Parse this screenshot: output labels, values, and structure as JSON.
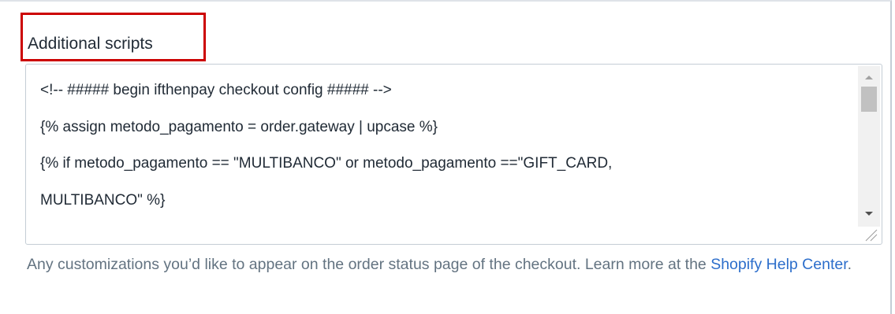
{
  "field": {
    "label": "Additional scripts"
  },
  "textarea": {
    "lines": [
      "<!-- ##### begin ifthenpay checkout config ##### -->",
      "{% assign metodo_pagamento = order.gateway | upcase %}",
      "{% if metodo_pagamento == \"MULTIBANCO\" or metodo_pagamento ==\"GIFT_CARD,",
      "MULTIBANCO\" %}"
    ]
  },
  "help": {
    "text_before": "Any customizations you’d like to appear on the order status page of the checkout. Learn more at the ",
    "link_text": "Shopify Help Center",
    "text_after": "."
  },
  "colors": {
    "highlight_border": "#cc0000",
    "link": "#2c6ecb",
    "help_text": "#637381",
    "body_text": "#212b36"
  }
}
